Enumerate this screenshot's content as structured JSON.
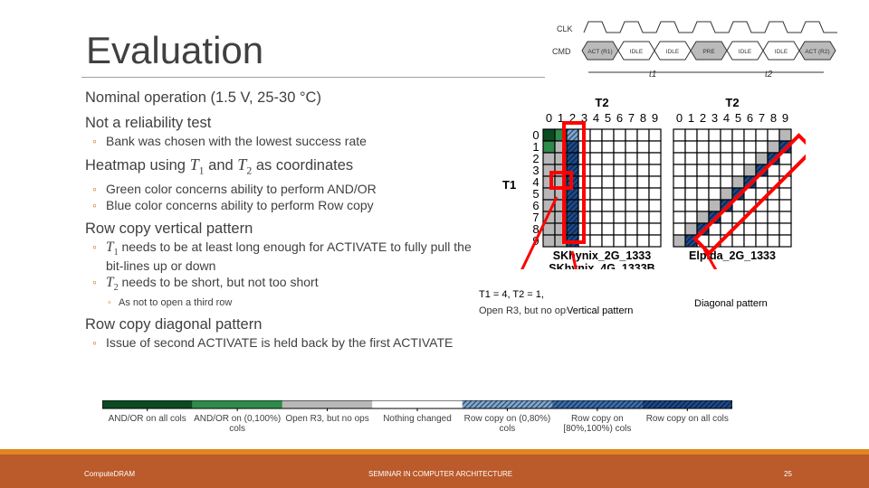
{
  "slide": {
    "title": "Evaluation"
  },
  "bullets": [
    {
      "text": "Nominal operation (1.5 V, 25-30 °C)",
      "children": []
    },
    {
      "text": "Not a reliability test",
      "children": [
        {
          "text": "Bank was chosen with the lowest success rate"
        }
      ]
    },
    {
      "pre": "Heatmap using ",
      "t1": "T",
      "t1sub": "1",
      "mid": " and ",
      "t2": "T",
      "t2sub": "2",
      "post": " as coordinates",
      "children": [
        {
          "text": "Green color concerns ability to perform AND/OR"
        },
        {
          "text": "Blue color concerns ability to perform Row copy"
        }
      ]
    },
    {
      "text": "Row copy vertical pattern",
      "children": [
        {
          "m": "T",
          "sub": "1",
          "text": " needs to be at least long enough for ACTIVATE to fully pull the bit-lines up or down"
        },
        {
          "m": "T",
          "sub": "2",
          "text": " needs to be short, but not too short",
          "children": [
            {
              "text": "As not to open a third row"
            }
          ]
        }
      ]
    },
    {
      "text": "Row copy diagonal pattern",
      "children": [
        {
          "text": "Issue of second ACTIVATE is held back by the first ACTIVATE"
        }
      ]
    }
  ],
  "timing": {
    "clk": "CLK",
    "cmd": "CMD",
    "commands": [
      "ACT (R1)",
      "IDLE",
      "IDLE",
      "PRE",
      "IDLE",
      "IDLE",
      "ACT (R2)"
    ],
    "t1": "t1",
    "t2": "t2"
  },
  "heatmaps": {
    "x_title": "T2",
    "y_title": "T1",
    "ticks": [
      "0",
      "1",
      "2",
      "3",
      "4",
      "5",
      "6",
      "7",
      "8",
      "9"
    ],
    "left": {
      "labels": [
        "SKhynix_2G_1333",
        "SKhynix_4G_1333B"
      ],
      "cells": [
        [
          0,
          1,
          4,
          3,
          3,
          3,
          3,
          3,
          3,
          3
        ],
        [
          1,
          2,
          6,
          3,
          3,
          3,
          3,
          3,
          3,
          3
        ],
        [
          2,
          2,
          6,
          3,
          3,
          3,
          3,
          3,
          3,
          3
        ],
        [
          2,
          2,
          6,
          3,
          3,
          3,
          3,
          3,
          3,
          3
        ],
        [
          2,
          2,
          6,
          3,
          3,
          3,
          3,
          3,
          3,
          3
        ],
        [
          2,
          2,
          6,
          3,
          3,
          3,
          3,
          3,
          3,
          3
        ],
        [
          2,
          2,
          6,
          3,
          3,
          3,
          3,
          3,
          3,
          3
        ],
        [
          2,
          2,
          6,
          3,
          3,
          3,
          3,
          3,
          3,
          3
        ],
        [
          2,
          2,
          6,
          3,
          3,
          3,
          3,
          3,
          3,
          3
        ],
        [
          2,
          2,
          6,
          3,
          3,
          3,
          3,
          3,
          3,
          3
        ]
      ]
    },
    "right": {
      "labels": [
        "Elpida_2G_1333"
      ],
      "cells": [
        [
          3,
          3,
          3,
          3,
          3,
          3,
          3,
          3,
          3,
          2
        ],
        [
          3,
          3,
          3,
          3,
          3,
          3,
          3,
          3,
          2,
          6
        ],
        [
          3,
          3,
          3,
          3,
          3,
          3,
          3,
          2,
          6,
          3
        ],
        [
          3,
          3,
          3,
          3,
          3,
          3,
          2,
          6,
          3,
          3
        ],
        [
          3,
          3,
          3,
          3,
          3,
          2,
          6,
          3,
          3,
          3
        ],
        [
          3,
          3,
          3,
          3,
          2,
          6,
          3,
          3,
          3,
          3
        ],
        [
          3,
          3,
          3,
          2,
          6,
          3,
          3,
          3,
          3,
          3
        ],
        [
          3,
          3,
          2,
          6,
          3,
          3,
          3,
          3,
          3,
          3
        ],
        [
          3,
          2,
          6,
          3,
          3,
          3,
          3,
          3,
          3,
          3
        ],
        [
          2,
          6,
          3,
          3,
          3,
          3,
          3,
          3,
          3,
          3
        ]
      ]
    }
  },
  "annotations": {
    "point": "T1 = 4, T2 = 1,",
    "point2": "Open R3, but no ops",
    "vertical": "Vertical pattern",
    "diagonal": "Diagonal pattern"
  },
  "legend": [
    {
      "label": "AND/OR on all cols",
      "color": "#0b4a22",
      "hatch": false
    },
    {
      "label": "AND/OR on (0,100%) cols",
      "color": "#2e8b4a",
      "hatch": false
    },
    {
      "label": "Open R3, but no ops",
      "color": "#b8b8b8",
      "hatch": false
    },
    {
      "label": "Nothing changed",
      "color": "#ffffff",
      "hatch": false
    },
    {
      "label": "Row copy on (0,80%) cols",
      "color": "#7ea8d6",
      "hatch": true
    },
    {
      "label": "Row copy on [80%,100%) cols",
      "color": "#3a6fb0",
      "hatch": true
    },
    {
      "label": "Row copy on all cols",
      "color": "#1c4a8c",
      "hatch": true
    }
  ],
  "footer": {
    "left": "ComputeDRAM",
    "center": "SEMINAR IN COMPUTER ARCHITECTURE",
    "page": "25"
  },
  "colors": {
    "accent": "#e0861e",
    "footer": "#bb5a2a",
    "highlight": "#ff0000"
  }
}
